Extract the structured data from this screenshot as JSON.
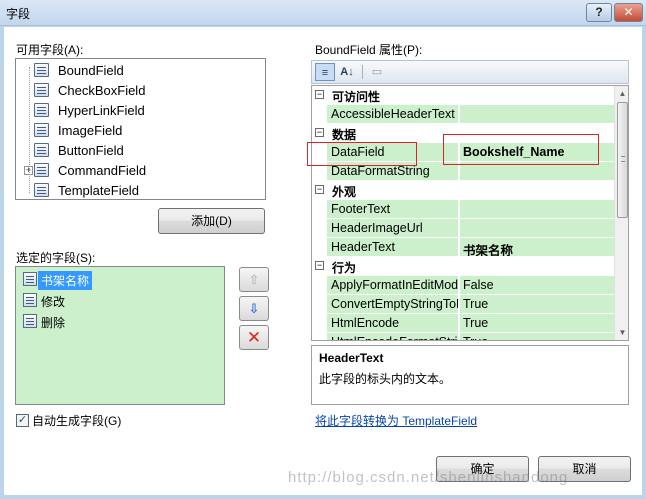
{
  "window": {
    "title": "字段",
    "help_label": "?",
    "close_label": "✕"
  },
  "available_fields": {
    "label": "可用字段(A):",
    "items": [
      {
        "label": "BoundField",
        "icon": "boundfield-icon"
      },
      {
        "label": "CheckBoxField",
        "icon": "checkboxfield-icon"
      },
      {
        "label": "HyperLinkField",
        "icon": "hyperlinkfield-icon"
      },
      {
        "label": "ImageField",
        "icon": "imagefield-icon"
      },
      {
        "label": "ButtonField",
        "icon": "buttonfield-icon"
      },
      {
        "label": "CommandField",
        "icon": "commandfield-icon",
        "expandable": true
      },
      {
        "label": "TemplateField",
        "icon": "templatefield-icon"
      }
    ],
    "expander": "+",
    "add_button": "添加(D)"
  },
  "selected_fields": {
    "label": "选定的字段(S):",
    "items": [
      {
        "label": "书架名称",
        "selected": true
      },
      {
        "label": "修改",
        "selected": false
      },
      {
        "label": "删除",
        "selected": false
      }
    ],
    "move_up": "⇧",
    "move_down": "⇩",
    "delete": "✕"
  },
  "auto_generate": {
    "checked": true,
    "mark": "✓",
    "label": "自动生成字段(G)"
  },
  "properties": {
    "label": "BoundField 属性(P):",
    "toolbar": {
      "categorized": "≡",
      "alphabetical": "A↓",
      "property_pages": "▭"
    },
    "rows": [
      {
        "type": "category",
        "toggle": "−",
        "label": "可访问性"
      },
      {
        "type": "property",
        "name": "AccessibleHeaderText",
        "value": ""
      },
      {
        "type": "category",
        "toggle": "−",
        "label": "数据"
      },
      {
        "type": "property",
        "name": "DataField",
        "value": "Bookshelf_Name",
        "bold": true
      },
      {
        "type": "property",
        "name": "DataFormatString",
        "value": ""
      },
      {
        "type": "category",
        "toggle": "−",
        "label": "外观"
      },
      {
        "type": "property",
        "name": "FooterText",
        "value": ""
      },
      {
        "type": "property",
        "name": "HeaderImageUrl",
        "value": ""
      },
      {
        "type": "property",
        "name": "HeaderText",
        "value": "书架名称",
        "bold": true
      },
      {
        "type": "category",
        "toggle": "−",
        "label": "行为"
      },
      {
        "type": "property",
        "name": "ApplyFormatInEditMode",
        "value": "False"
      },
      {
        "type": "property",
        "name": "ConvertEmptyStringToNull",
        "value": "True"
      },
      {
        "type": "property",
        "name": "HtmlEncode",
        "value": "True"
      },
      {
        "type": "property",
        "name": "HtmlEncodeFormatString",
        "value": "True"
      }
    ],
    "scroll_up": "▲",
    "scroll_down": "▼"
  },
  "description": {
    "title": "HeaderText",
    "text": "此字段的标头内的文本。"
  },
  "convert_link": "将此字段转换为 TemplateField",
  "buttons": {
    "ok": "确定",
    "cancel": "取消"
  },
  "watermark": "http://blog.csdn.net/shenlinshandong",
  "colors": {
    "selection": "#3399ff",
    "grid_fill": "#ccefcc",
    "annotation": "#d8232a",
    "link": "#0645ad"
  }
}
